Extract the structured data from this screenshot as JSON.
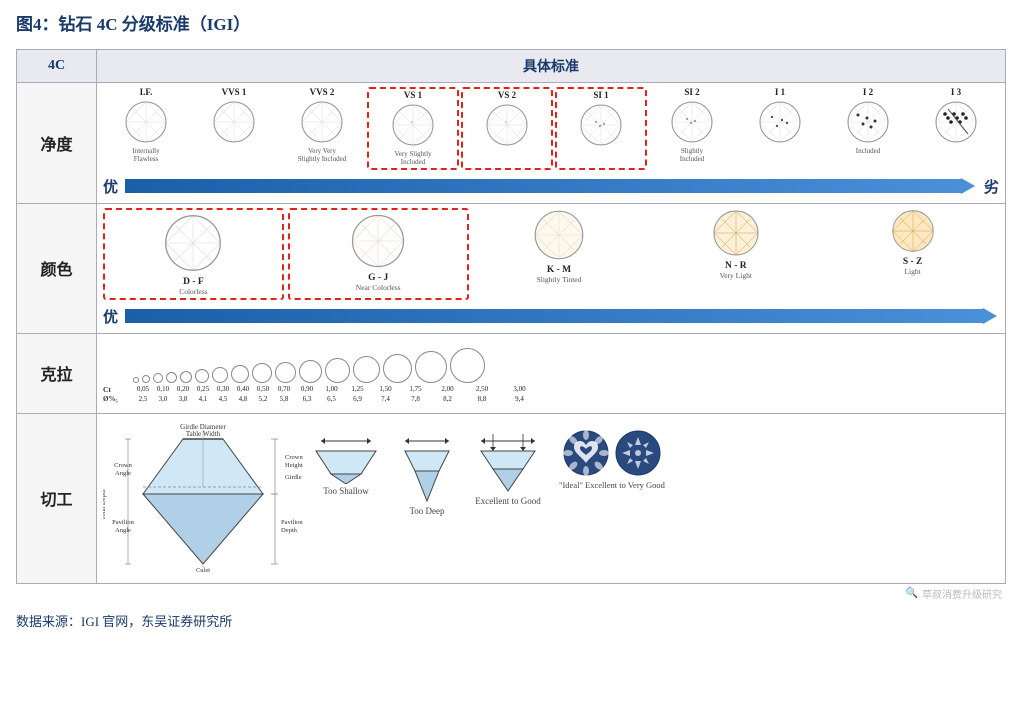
{
  "title": "图4：钻石 4C 分级标准（IGI）",
  "header": {
    "col1": "4C",
    "col2": "具体标准"
  },
  "clarity": {
    "label": "净度",
    "grades": [
      {
        "code": "I.F.",
        "desc": "Internally\nFlawless",
        "highlight": false
      },
      {
        "code": "VVS 1",
        "desc": "",
        "highlight": false
      },
      {
        "code": "VVS 2",
        "desc": "Very Very\nSlightly Included",
        "highlight": false
      },
      {
        "code": "VS 1",
        "desc": "Very Slightly\nIncluded",
        "highlight": true
      },
      {
        "code": "VS 2",
        "desc": "",
        "highlight": true
      },
      {
        "code": "SI 1",
        "desc": "",
        "highlight": true
      },
      {
        "code": "SI 2",
        "desc": "Slightly\nIncluded",
        "highlight": false
      },
      {
        "code": "I 1",
        "desc": "",
        "highlight": false
      },
      {
        "code": "I 2",
        "desc": "Included",
        "highlight": false
      },
      {
        "code": "I 3",
        "desc": "",
        "highlight": false
      }
    ],
    "you": "优",
    "jia": "劣"
  },
  "color": {
    "label": "颜色",
    "grades": [
      {
        "code": "D - F",
        "desc": "Colorless",
        "highlight": true,
        "tint": 0
      },
      {
        "code": "G - J",
        "desc": "Near Colorless",
        "highlight": true,
        "tint": 0.05
      },
      {
        "code": "K - M",
        "desc": "Slightly Tinted",
        "highlight": false,
        "tint": 0.25
      },
      {
        "code": "N - R",
        "desc": "Very Light",
        "highlight": false,
        "tint": 0.5
      },
      {
        "code": "S - Z",
        "desc": "Light",
        "highlight": false,
        "tint": 0.8
      }
    ],
    "you": "优"
  },
  "carat": {
    "label": "克拉",
    "ct_label": "Ct",
    "diameter_label": "Ø%₅",
    "values": [
      {
        "ct": "0,05",
        "d": "2,5"
      },
      {
        "ct": "0,10",
        "d": "3,0"
      },
      {
        "ct": "0,20",
        "d": "3,8"
      },
      {
        "ct": "0,25",
        "d": "4,1"
      },
      {
        "ct": "0,30",
        "d": "4,5"
      },
      {
        "ct": "0,40",
        "d": "4,8"
      },
      {
        "ct": "0,50",
        "d": "5,2"
      },
      {
        "ct": "0,70",
        "d": "5,8"
      },
      {
        "ct": "0,90",
        "d": "6,3"
      },
      {
        "ct": "1,00",
        "d": "6,5"
      },
      {
        "ct": "1,25",
        "d": "6,9"
      },
      {
        "ct": "1,50",
        "d": "7,4"
      },
      {
        "ct": "1,75",
        "d": "7,8"
      },
      {
        "ct": "2,00",
        "d": "8,2"
      },
      {
        "ct": "2,50",
        "d": "8,8"
      },
      {
        "ct": "3,00",
        "d": "9,4"
      }
    ]
  },
  "cut": {
    "label": "切工",
    "diagram": {
      "labels": [
        "Girdle Diameter",
        "Crown Angle",
        "Table Width",
        "Crown Height",
        "Girdle",
        "Total Depth",
        "Pavilion Angle",
        "Pavilion Depth",
        "Culet"
      ]
    },
    "examples": [
      {
        "label": "Too Shallow",
        "type": "shallow"
      },
      {
        "label": "Too Deep",
        "type": "deep"
      },
      {
        "label": "Excellent to Good",
        "type": "excellent"
      },
      {
        "label": "\"Ideal\"\nExcellent to Very Good",
        "type": "ideal"
      }
    ]
  },
  "watermark": "草叔消费升级研究",
  "footer": "数据来源：IGI 官网，东吴证券研究所"
}
